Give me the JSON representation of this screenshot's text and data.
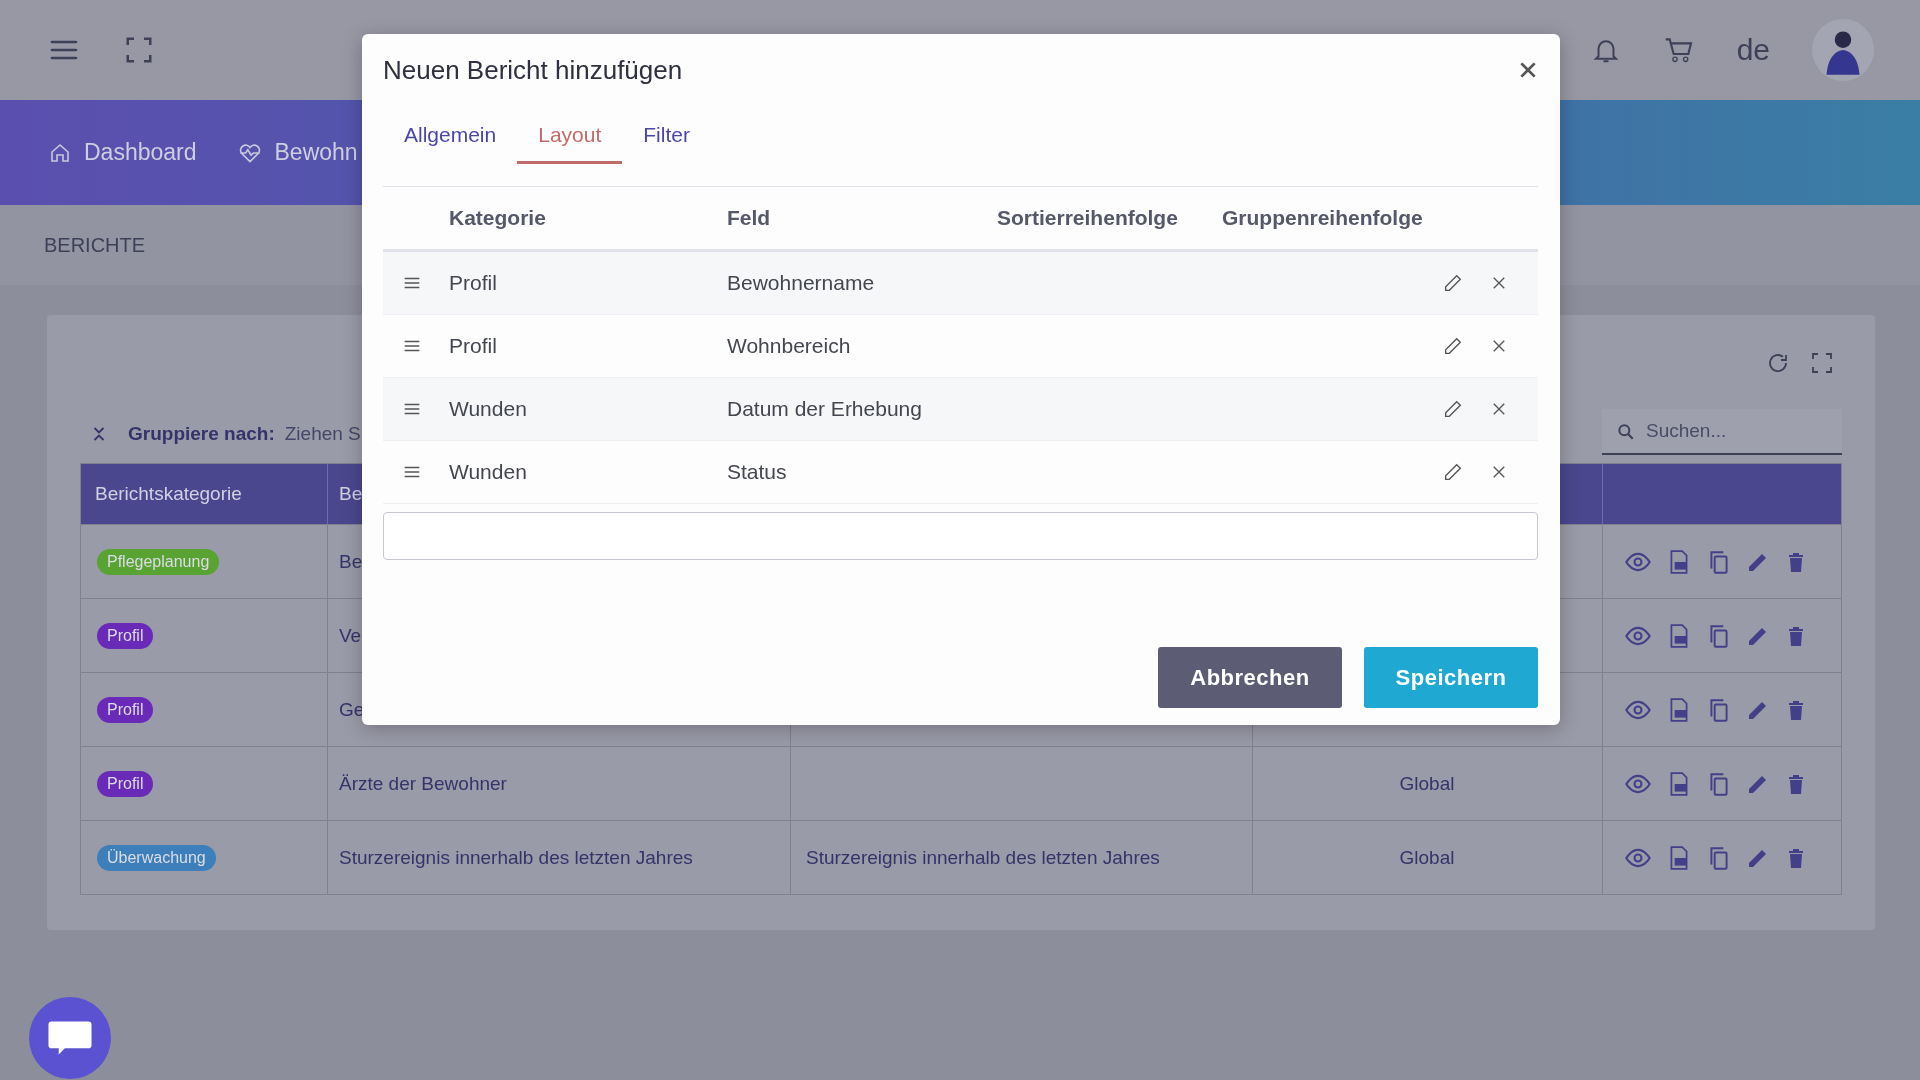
{
  "header": {
    "language": "de"
  },
  "nav": {
    "items": [
      {
        "label": "Dashboard",
        "kind": "home"
      },
      {
        "label": "Bewohn",
        "kind": "heart"
      }
    ]
  },
  "breadcrumb": "BERICHTE",
  "report_list": {
    "group_by": {
      "label": "Gruppiere nach:",
      "hint": "Ziehen S"
    },
    "search": {
      "placeholder": "Suchen..."
    },
    "columns": [
      "Berichtskategorie",
      "Be"
    ],
    "rows": [
      {
        "category": {
          "label": "Pflegeplanung",
          "color": "#58a332"
        },
        "column_2": "Be"
      },
      {
        "category": {
          "label": "Profil",
          "color": "#6a2ab8"
        },
        "column_2": "Ve"
      },
      {
        "category": {
          "label": "Profil",
          "color": "#6a2ab8"
        },
        "column_2": "Ge"
      },
      {
        "category": {
          "label": "Profil",
          "color": "#6a2ab8"
        },
        "column_2": "Ärzte der Bewohner",
        "column_4": "Global"
      },
      {
        "category": {
          "label": "Überwachung",
          "color": "#3d7fba"
        },
        "column_2": "Sturzereignis innerhalb des letzten Jahres",
        "column_3": "Sturzereignis innerhalb des letzten Jahres",
        "column_4": "Global"
      }
    ]
  },
  "dialog": {
    "title": "Neuen Bericht hinzufügen",
    "tabs": [
      {
        "label": "Allgemein",
        "selected": false
      },
      {
        "label": "Layout",
        "selected": true
      },
      {
        "label": "Filter",
        "selected": false
      }
    ],
    "columns": [
      "Kategorie",
      "Feld",
      "Sortierreihenfolge",
      "Gruppenreihenfolge"
    ],
    "rows": [
      {
        "category": "Profil",
        "field": "Bewohnername"
      },
      {
        "category": "Profil",
        "field": "Wohnbereich"
      },
      {
        "category": "Wunden",
        "field": "Datum der Erhebung"
      },
      {
        "category": "Wunden",
        "field": "Status"
      }
    ],
    "buttons": [
      {
        "label": "Abbrechen",
        "kind": "secondary"
      },
      {
        "label": "Speichern",
        "kind": "primary"
      }
    ]
  }
}
